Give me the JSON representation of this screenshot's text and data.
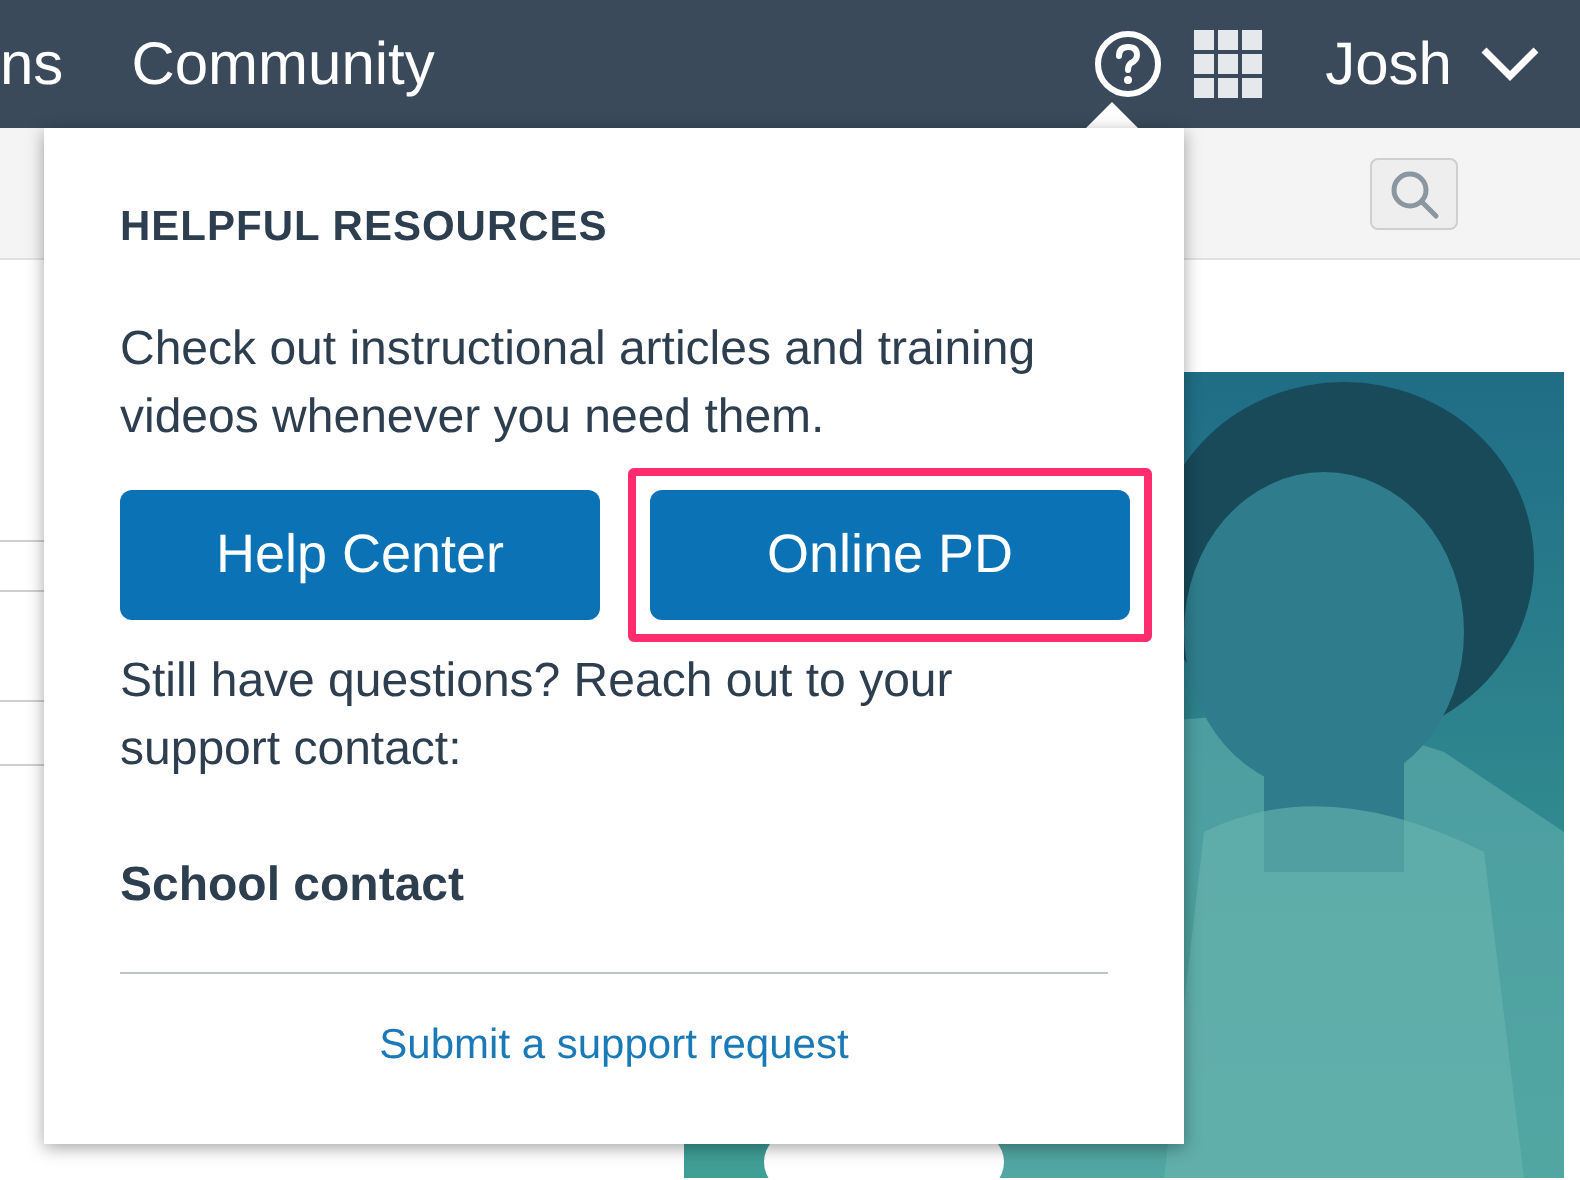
{
  "nav": {
    "items": [
      "ns",
      "Community"
    ],
    "user": "Josh"
  },
  "popover": {
    "heading": "HELPFUL RESOURCES",
    "intro": "Check out instructional articles and training videos whenever you need them.",
    "buttons": [
      {
        "label": "Help Center",
        "highlighted": false
      },
      {
        "label": "Online PD",
        "highlighted": true
      }
    ],
    "question": "Still have questions? Reach out to your support contact:",
    "contact": "School contact",
    "link": "Submit a support request"
  }
}
